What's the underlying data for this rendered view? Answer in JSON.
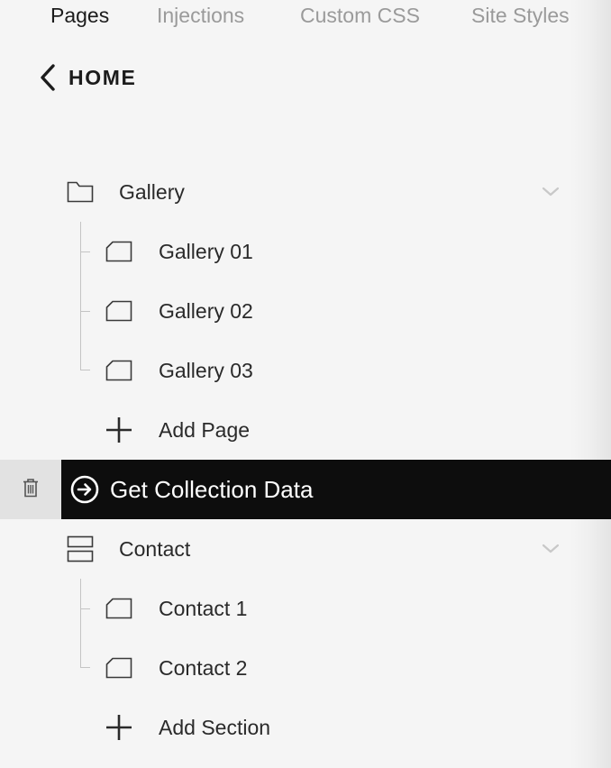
{
  "tabs": [
    {
      "label": "Pages",
      "active": true
    },
    {
      "label": "Injections",
      "active": false
    },
    {
      "label": "Custom CSS",
      "active": false
    },
    {
      "label": "Site Styles",
      "active": false
    }
  ],
  "nav": {
    "back_label": "HOME",
    "back_icon": "chevron-left-icon"
  },
  "tree": {
    "gallery_folder": {
      "label": "Gallery",
      "icon": "folder-icon",
      "expanded": true,
      "pages": [
        {
          "label": "Gallery 01",
          "icon": "page-icon"
        },
        {
          "label": "Gallery 02",
          "icon": "page-icon"
        },
        {
          "label": "Gallery 03",
          "icon": "page-icon"
        }
      ],
      "add_label": "Add Page"
    },
    "selected_item": {
      "label": "Get Collection Data",
      "icon": "link-arrow-icon",
      "action_icon": "trash-icon"
    },
    "contact_folder": {
      "label": "Contact",
      "icon": "index-icon",
      "expanded": true,
      "pages": [
        {
          "label": "Contact 1",
          "icon": "page-icon"
        },
        {
          "label": "Contact 2",
          "icon": "page-icon"
        }
      ],
      "add_label": "Add Section"
    }
  },
  "colors": {
    "background": "#f5f5f5",
    "selected_background": "#0d0d0d",
    "selected_text": "#ffffff",
    "inactive_tab": "#9a9a9a",
    "tree_line": "#c4c4c4"
  }
}
